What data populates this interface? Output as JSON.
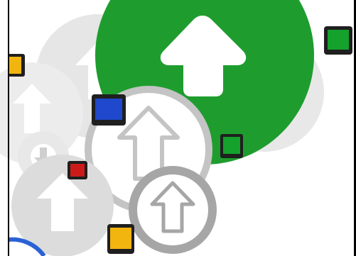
{
  "illustration": {
    "theme": "upload-arrows-with-phones",
    "colors": {
      "primary_arrow_circle": "#1e9d2e",
      "faint_circle": "#e4e4e4",
      "mid_circle": "#c4c4c4",
      "dark_ring": "#a6a6a6",
      "phone_body": "#1f1f1f",
      "screen_green": "#14a12c",
      "screen_blue": "#1f48cc",
      "screen_yellow": "#f2b40f",
      "screen_red": "#cc1a1a",
      "partial_ring_blue": "#2a62d6",
      "frame": "#000000"
    },
    "icons": [
      "upload-arrow-icon",
      "download-arrow-icon",
      "smartphone-icon"
    ]
  }
}
